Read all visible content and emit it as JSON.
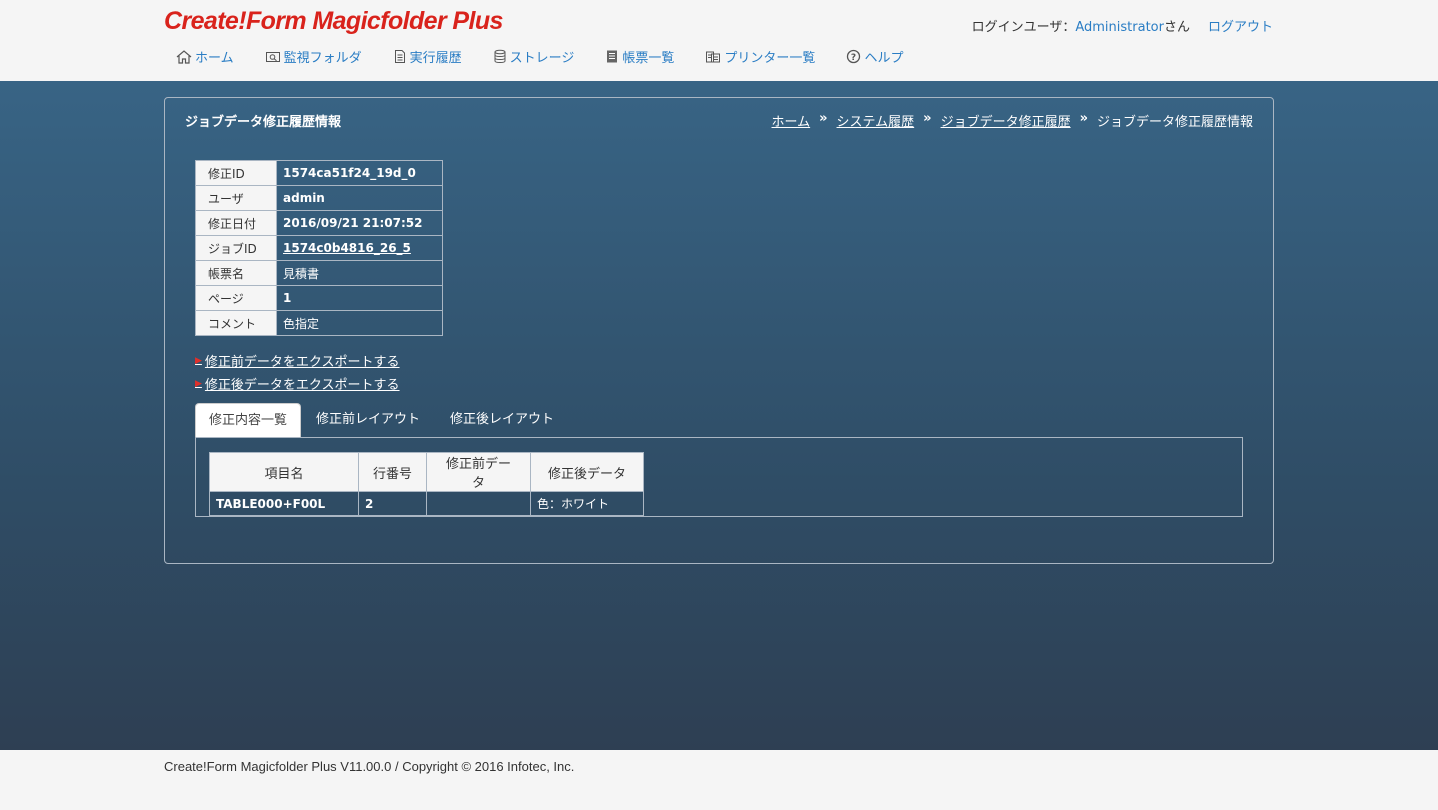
{
  "app": {
    "logo": "Create!Form Magicfolder Plus"
  },
  "user": {
    "label": "ログインユーザ：",
    "name": "Administrator",
    "suffix": "さん",
    "logout": "ログアウト"
  },
  "nav": [
    {
      "label": "ホーム",
      "icon": "home-icon"
    },
    {
      "label": "監視フォルダ",
      "icon": "folder-watch-icon"
    },
    {
      "label": "実行履歴",
      "icon": "document-icon"
    },
    {
      "label": "ストレージ",
      "icon": "database-icon"
    },
    {
      "label": "帳票一覧",
      "icon": "form-list-icon"
    },
    {
      "label": "プリンター一覧",
      "icon": "printer-icon"
    },
    {
      "label": "ヘルプ",
      "icon": "help-icon"
    }
  ],
  "page": {
    "title": "ジョブデータ修正履歴情報",
    "breadcrumb": [
      "ホーム",
      "システム履歴",
      "ジョブデータ修正履歴",
      "ジョブデータ修正履歴情報"
    ],
    "breadcrumb_sep": "»"
  },
  "info": [
    {
      "label": "修正ID",
      "value": "1574ca51f24_19d_0"
    },
    {
      "label": "ユーザ",
      "value": "admin"
    },
    {
      "label": "修正日付",
      "value": "2016/09/21 21:07:52"
    },
    {
      "label": "ジョブID",
      "value": "1574c0b4816_26_5"
    },
    {
      "label": "帳票名",
      "value": "見積書"
    },
    {
      "label": "ページ",
      "value": "1"
    },
    {
      "label": "コメント",
      "value": "色指定"
    }
  ],
  "exports": {
    "arrow": "▶",
    "before": "修正前データをエクスポートする",
    "after": "修正後データをエクスポートする"
  },
  "tabs": [
    "修正内容一覧",
    "修正前レイアウト",
    "修正後レイアウト"
  ],
  "diff": {
    "headers": [
      "項目名",
      "行番号",
      "修正前データ",
      "修正後データ"
    ],
    "rows": [
      {
        "item": "TABLE000+F00L",
        "line": "2",
        "before": "",
        "after": "色：ホワイト"
      }
    ]
  },
  "footer": {
    "text": "Create!Form Magicfolder Plus V11.00.0 / Copyright © 2016 Infotec, Inc."
  }
}
